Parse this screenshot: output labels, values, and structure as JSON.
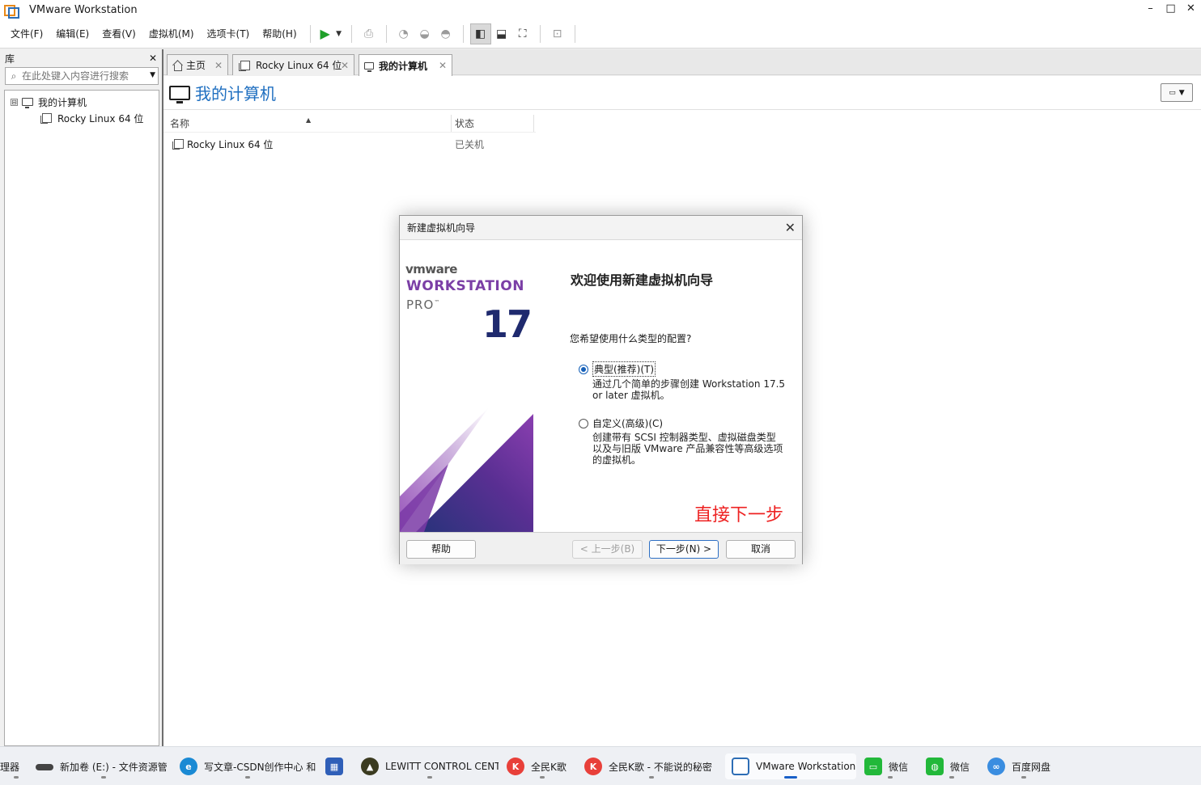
{
  "window": {
    "title": "VMware Workstation",
    "minimize": "–",
    "maximize": "□",
    "close": "✕"
  },
  "menu": [
    "文件(F)",
    "编辑(E)",
    "查看(V)",
    "虚拟机(M)",
    "选项卡(T)",
    "帮助(H)"
  ],
  "library": {
    "title": "库",
    "close": "✕",
    "search_placeholder": "在此处键入内容进行搜索",
    "tree": {
      "root": "我的计算机",
      "expander": "⊟",
      "child": "Rocky Linux 64 位"
    }
  },
  "tabs": [
    {
      "label": "主页",
      "icon": "home-icon"
    },
    {
      "label": "Rocky Linux 64 位",
      "icon": "vm-icon"
    },
    {
      "label": "我的计算机",
      "icon": "computer-icon"
    }
  ],
  "main": {
    "title": "我的计算机",
    "columns": {
      "name": "名称",
      "status": "状态"
    },
    "rows": [
      {
        "name": "Rocky Linux 64 位",
        "status": "已关机"
      }
    ]
  },
  "dialog": {
    "title": "新建虚拟机向导",
    "close": "✕",
    "brand": {
      "vendor": "vmware",
      "product": "WORKSTATION",
      "edition": "PRO",
      "tm": "™",
      "version": "17"
    },
    "heading": "欢迎使用新建虚拟机向导",
    "question": "您希望使用什么类型的配置?",
    "options": [
      {
        "label": "典型(推荐)(T)",
        "checked": true,
        "desc": [
          "通过几个简单的步骤创建 Workstation 17.5",
          "or later 虚拟机。"
        ]
      },
      {
        "label": "自定义(高级)(C)",
        "checked": false,
        "desc": [
          "创建带有 SCSI 控制器类型、虚拟磁盘类型",
          "以及与旧版 VMware 产品兼容性等高级选项",
          "的虚拟机。"
        ]
      }
    ],
    "annotation": "直接下一步",
    "buttons": {
      "help": "帮助",
      "back": "< 上一步(B)",
      "next": "下一步(N) >",
      "cancel": "取消"
    }
  },
  "taskbar": [
    {
      "label": "理器",
      "icon": "file-manager-icon",
      "color": "#f0f0f0"
    },
    {
      "label": "新加卷 (E:) - 文件资源管",
      "icon": "drive-icon",
      "color": "#444444"
    },
    {
      "label": "写文章-CSDN创作中心 和",
      "icon": "edge-icon",
      "color": "#1a8ad4"
    },
    {
      "label": "",
      "icon": "store-icon",
      "color": "#2f5fb8"
    },
    {
      "label": "LEWITT CONTROL CENT",
      "icon": "lewitt-icon",
      "color": "#3b3b20"
    },
    {
      "label": "全民K歌",
      "icon": "kge-icon",
      "color": "#e8403a"
    },
    {
      "label": "全民K歌 - 不能说的秘密",
      "icon": "kge-icon",
      "color": "#e8403a"
    },
    {
      "label": "VMware Workstation",
      "icon": "vmware-icon",
      "color": "#2d6db5"
    },
    {
      "label": "微信",
      "icon": "wechat-message-icon",
      "color": "#22b83a"
    },
    {
      "label": "微信",
      "icon": "wechat-icon",
      "color": "#22b83a"
    },
    {
      "label": "百度网盘",
      "icon": "baidu-netdisk-icon",
      "color": "#3a8de0"
    }
  ],
  "colors": {
    "accent": "#1f6fc0",
    "annotation": "#ee2222",
    "brand_purple": "#7b3fa6",
    "brand_navy": "#1f2a6e"
  }
}
